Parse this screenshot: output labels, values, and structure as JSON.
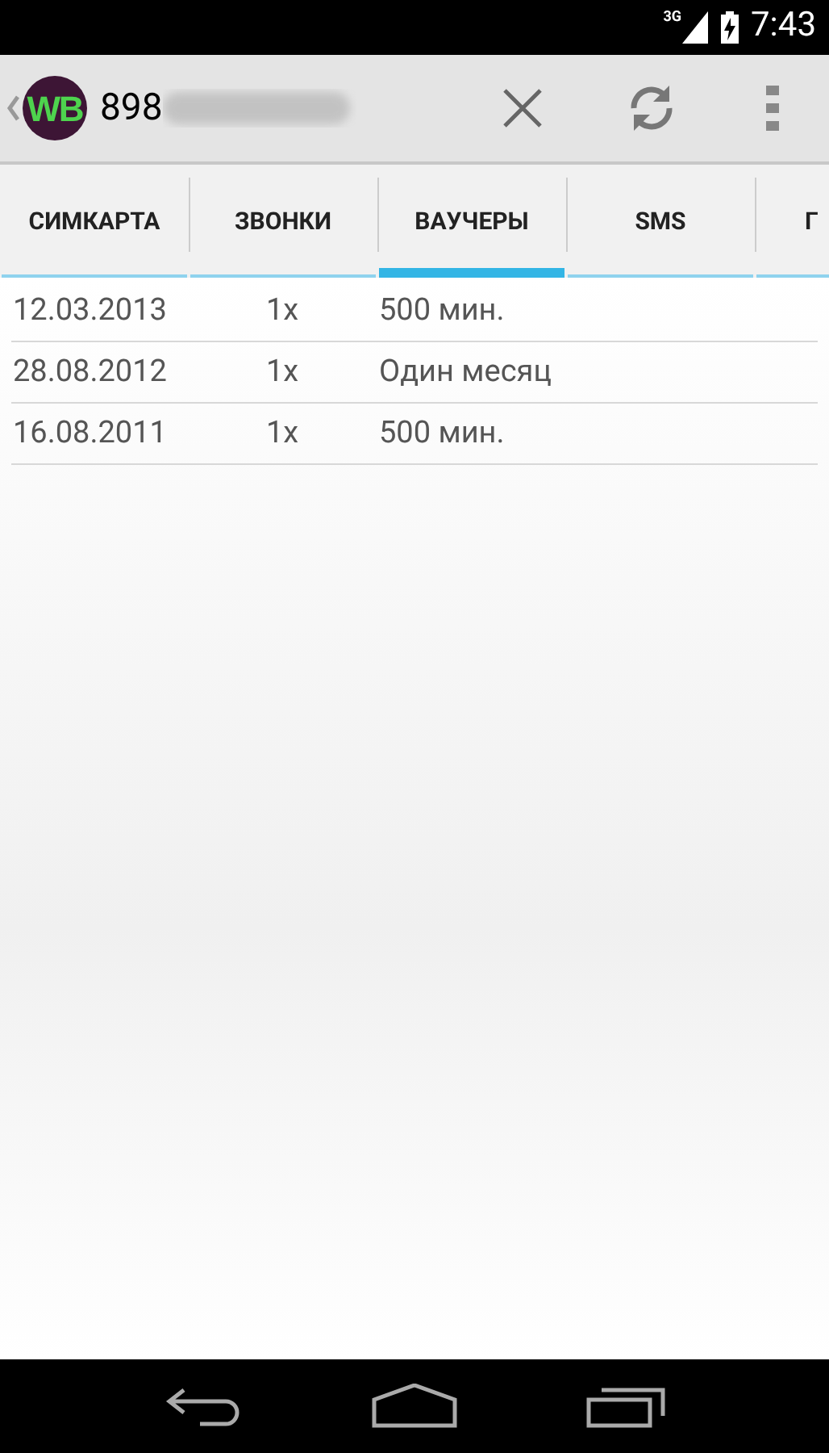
{
  "status_bar": {
    "network": "3G",
    "time": "7:43"
  },
  "action_bar": {
    "logo": "WB",
    "title": "898"
  },
  "tabs": [
    {
      "label": "СИМКАРТА",
      "selected": false
    },
    {
      "label": "ЗВОНКИ",
      "selected": false
    },
    {
      "label": "ВАУЧЕРЫ",
      "selected": true
    },
    {
      "label": "SMS",
      "selected": false
    },
    {
      "label": "Г",
      "selected": false
    }
  ],
  "table": {
    "rows": [
      [
        "12.03.2013",
        "1x",
        "500 мин."
      ],
      [
        "28.08.2012",
        "1x",
        "Один месяц"
      ],
      [
        "16.08.2011",
        "1x",
        "500 мин."
      ]
    ]
  }
}
